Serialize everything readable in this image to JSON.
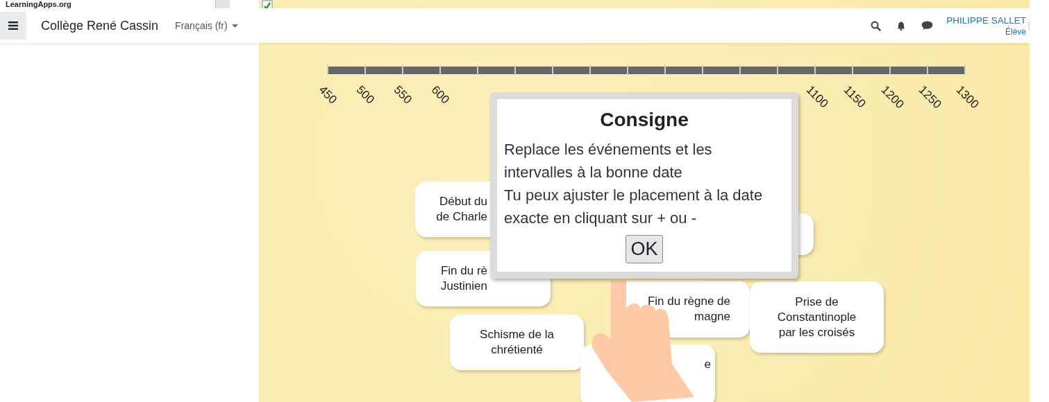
{
  "top_strip": {
    "title": "LearningApps.org"
  },
  "navbar": {
    "site_name": "Collège René Cassin",
    "language": "Français (fr)",
    "user_name": "PHILIPPE SALLET",
    "user_role": "Élève"
  },
  "timeline": {
    "labels_start": [
      "450",
      "500",
      "550",
      "600"
    ],
    "labels_end": [
      "1100",
      "1150",
      "1200",
      "1250",
      "1300"
    ]
  },
  "cards": [
    {
      "kind": "text",
      "lines": [
        "Début du",
        "de Charle"
      ]
    },
    {
      "kind": "blank"
    },
    {
      "kind": "text",
      "lines": [
        "Fin du rè",
        "Justinien"
      ]
    },
    {
      "kind": "text",
      "lines": [
        "Fin du règne de",
        "magne"
      ]
    },
    {
      "kind": "text",
      "lines": [
        "Prise de",
        "Constantinople",
        "par les croisés"
      ]
    },
    {
      "kind": "text",
      "lines": [
        "Schisme de la",
        "chrétienté"
      ]
    },
    {
      "kind": "text",
      "lines": [
        "e"
      ]
    }
  ],
  "dialog": {
    "title": "Consigne",
    "lines": [
      "Replace les événements et les",
      "intervalles à la bonne date",
      "Tu peux ajuster le placement à la date",
      "exacte en cliquant sur + ou -"
    ],
    "button": "OK"
  }
}
